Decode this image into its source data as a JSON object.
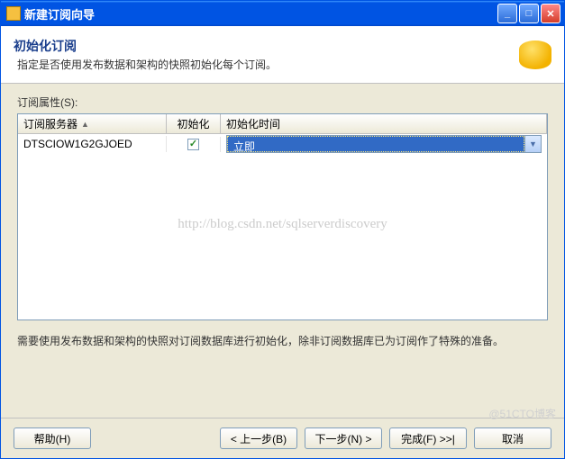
{
  "window": {
    "title": "新建订阅向导"
  },
  "header": {
    "title": "初始化订阅",
    "description": "指定是否使用发布数据和架构的快照初始化每个订阅。"
  },
  "section": {
    "label": "订阅属性(S):"
  },
  "grid": {
    "columns": {
      "server": "订阅服务器",
      "init": "初始化",
      "init_time": "初始化时间"
    },
    "rows": [
      {
        "server": "DTSCIOW1G2GJOED",
        "init_checked": true,
        "init_time": "立即"
      }
    ]
  },
  "watermark": "http://blog.csdn.net/sqlserverdiscovery",
  "note": "需要使用发布数据和架构的快照对订阅数据库进行初始化，除非订阅数据库已为订阅作了特殊的准备。",
  "buttons": {
    "help": "帮助(H)",
    "back": "< 上一步(B)",
    "next": "下一步(N) >",
    "finish": "完成(F) >>|",
    "cancel": "取消"
  },
  "corner_watermark": "@51CTO博客"
}
